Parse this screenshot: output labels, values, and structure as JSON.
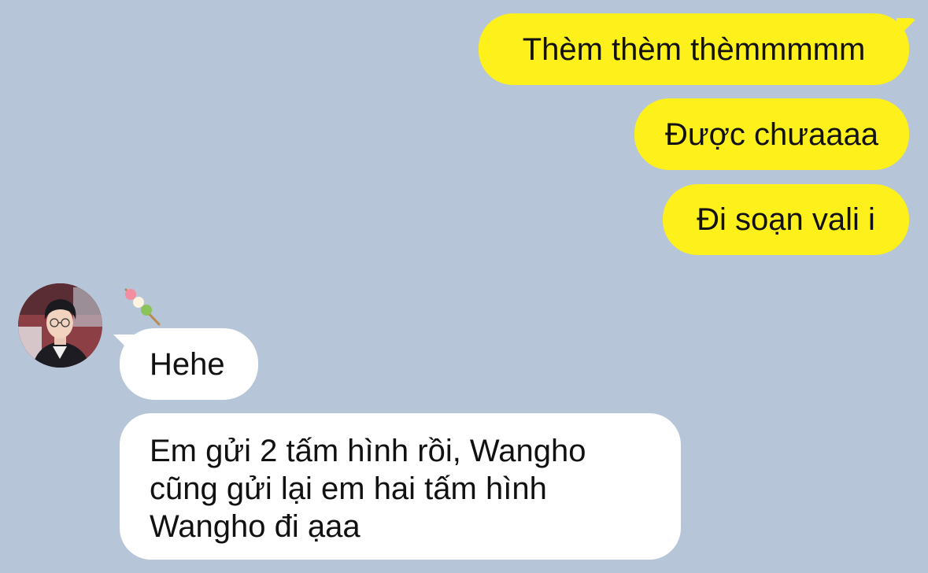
{
  "conversation": {
    "outgoing": [
      {
        "text": "Thèm thèm thèmmmmm"
      },
      {
        "text": "Được chưaaaa"
      },
      {
        "text": "Đi soạn vali i"
      }
    ],
    "contact": {
      "avatar_icon": "profile-photo-avatar",
      "name_emoji": "🍡"
    },
    "incoming": [
      {
        "text": "Hehe"
      },
      {
        "text": "Em gửi 2 tấm hình rồi, Wangho cũng gửi lại em hai tấm hình Wangho đi ạaa"
      }
    ]
  },
  "colors": {
    "background": "#b6c5d8",
    "outgoing_bubble": "#fef01b",
    "incoming_bubble": "#ffffff",
    "text": "#111111"
  }
}
